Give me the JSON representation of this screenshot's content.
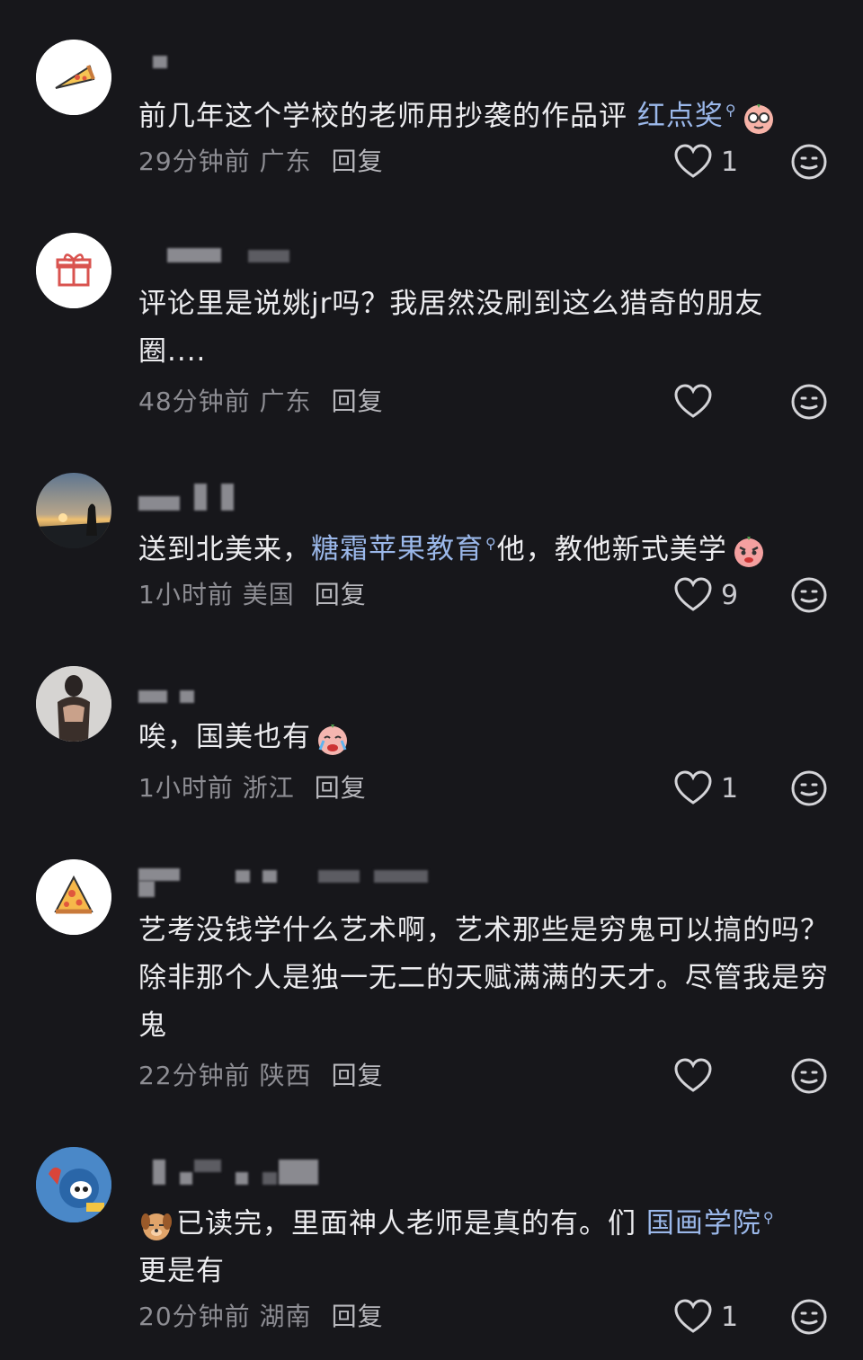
{
  "comments": [
    {
      "text_before": "前几年这个学校的老师用抄袭的作品评 ",
      "link": "红点奖",
      "text_after": "",
      "emoji": "nerd-face-emoji",
      "time": "29分钟前",
      "location": "广东",
      "reply": "回复",
      "likes": "1",
      "avatar": "pizza-avatar"
    },
    {
      "text_before": "评论里是说姚jr吗？我居然没刷到这么猎奇的朋友圈....",
      "link": "",
      "text_after": "",
      "emoji": "",
      "time": "48分钟前",
      "location": "广东",
      "reply": "回复",
      "likes": "",
      "avatar": "gift-avatar"
    },
    {
      "text_before": "送到北美来，",
      "link": "糖霜苹果教育",
      "text_after": "他，教他新式美学",
      "emoji": "angry-face-emoji",
      "time": "1小时前",
      "location": "美国",
      "reply": "回复",
      "likes": "9",
      "avatar": "sunset-photo-avatar"
    },
    {
      "text_before": "唉，国美也有",
      "link": "",
      "text_after": "",
      "emoji": "crying-face-emoji",
      "time": "1小时前",
      "location": "浙江",
      "reply": "回复",
      "likes": "1",
      "avatar": "portrait-photo-avatar"
    },
    {
      "text_before": "艺考没钱学什么艺术啊，艺术那些是穷鬼可以搞的吗？除非那个人是独一无二的天赋满满的天才。尽管我是穷鬼",
      "link": "",
      "text_after": "",
      "emoji": "",
      "time": "22分钟前",
      "location": "陕西",
      "reply": "回复",
      "likes": "",
      "avatar": "pizza-avatar"
    },
    {
      "text_before": "已读完，里面神人老师是真的有。们 ",
      "link": "国画学院",
      "text_after": "更是有",
      "emoji": "dog-emoji",
      "time": "20分钟前",
      "location": "湖南",
      "reply": "回复",
      "likes": "1",
      "avatar": "cartoon-avatar"
    }
  ],
  "colors": {
    "background": "#17171b",
    "link": "#9bb8ea",
    "meta": "#8d8d93"
  }
}
